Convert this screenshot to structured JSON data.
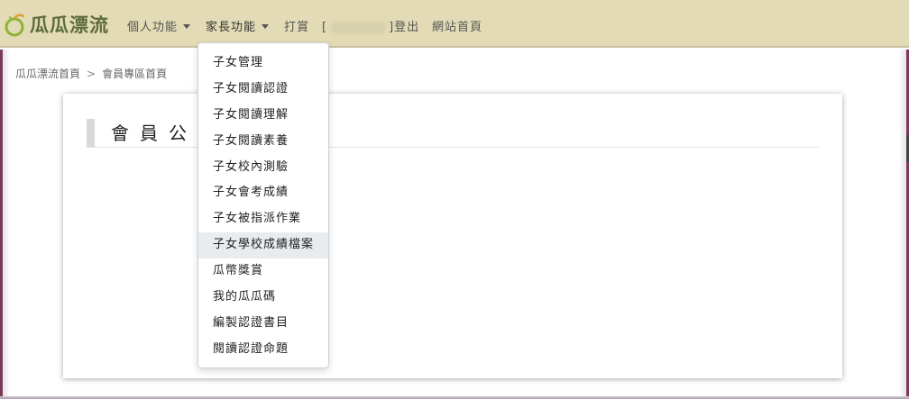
{
  "brand": {
    "name": "瓜瓜漂流"
  },
  "nav": {
    "personal": "個人功能",
    "parent": "家長功能",
    "reward": "打賞",
    "user_open": "[",
    "user_close": "]",
    "logout": "登出",
    "home": "網站首頁"
  },
  "breadcrumb": {
    "home": "瓜瓜漂流首頁",
    "separator": ">",
    "current": "會員專區首頁"
  },
  "card": {
    "title": "會員公"
  },
  "dropdown": {
    "items": [
      "子女管理",
      "子女閱讀認證",
      "子女閱讀理解",
      "子女閱讀素養",
      "子女校內測驗",
      "子女會考成績",
      "子女被指派作業",
      "子女學校成績檔案",
      "瓜幣獎賞",
      "我的瓜瓜碼",
      "編製認證書目",
      "閱讀認證命題"
    ],
    "hovered_index": 7
  },
  "colors": {
    "navbar": "#e2dbb5",
    "brand_text": "#5e6b3e",
    "frame": "#7a3a5a"
  }
}
